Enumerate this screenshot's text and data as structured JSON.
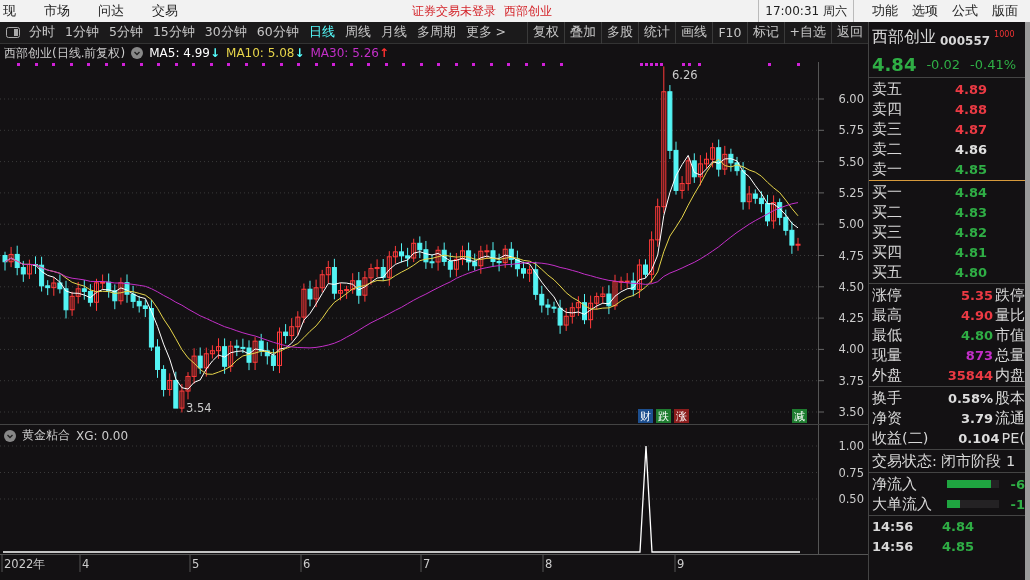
{
  "menu": [
    "现",
    "市场",
    "问达",
    "交易"
  ],
  "login_status": "证券交易未登录",
  "stock_title": "西部创业",
  "clock": "17:00:31 周六",
  "right_menu": [
    "功能",
    "选项",
    "公式",
    "版面"
  ],
  "periods": [
    {
      "label": "分时",
      "selected": false
    },
    {
      "label": "1分钟",
      "selected": false
    },
    {
      "label": "5分钟",
      "selected": false
    },
    {
      "label": "15分钟",
      "selected": false
    },
    {
      "label": "30分钟",
      "selected": false
    },
    {
      "label": "60分钟",
      "selected": false
    },
    {
      "label": "日线",
      "selected": true
    },
    {
      "label": "周线",
      "selected": false
    },
    {
      "label": "月线",
      "selected": false
    },
    {
      "label": "多周期",
      "selected": false
    }
  ],
  "more": "更多 >",
  "tools": [
    "复权",
    "叠加",
    "多股",
    "统计",
    "画线",
    "F10",
    "标记",
    "+自选",
    "返回"
  ],
  "chart": {
    "title": "西部创业(日线.前复权)",
    "ma": [
      {
        "label": "MA5: 4.99",
        "arrow": {
          "label": "↓",
          "color": "#55ffff"
        },
        "color": "#ffffff"
      },
      {
        "label": "MA10: 5.08",
        "arrow": {
          "label": "↓",
          "color": "#55ffff"
        },
        "color": "#e6d44a"
      },
      {
        "label": "MA30: 5.26",
        "arrow": {
          "label": "↑",
          "color": "#ff3030"
        },
        "color": "#c32fc8"
      }
    ],
    "y_ticks": [
      "6.00",
      "5.75",
      "5.50",
      "5.25",
      "5.00",
      "4.75",
      "4.50",
      "4.25",
      "4.00",
      "3.75",
      "3.50"
    ],
    "high_label": "6.26",
    "low_label": "3.54",
    "events": [
      {
        "label": "财",
        "color": "#1d4f8f"
      },
      {
        "label": "跌",
        "color": "#1f7d30"
      },
      {
        "label": "涨",
        "color": "#8c1d1d"
      },
      {
        "label": "减",
        "color": "#1f7d30"
      }
    ]
  },
  "indicator": {
    "title": "黄金粘合",
    "reading": "XG: 0.00",
    "y_ticks": [
      "1.00",
      "0.75",
      "0.50"
    ]
  },
  "date_axis": [
    "2022年",
    "4",
    "5",
    "6",
    "7",
    "8",
    "9"
  ],
  "quote": {
    "name": "西部创业",
    "code": "000557",
    "tag": "1000",
    "price": "4.84",
    "change": "-0.02",
    "percent": "-0.41%"
  },
  "order_book": [
    {
      "label": "卖五",
      "price": "4.89",
      "color": "#ec3a44"
    },
    {
      "label": "卖四",
      "price": "4.88",
      "color": "#ec3a44"
    },
    {
      "label": "卖三",
      "price": "4.87",
      "color": "#ec3a44"
    },
    {
      "label": "卖二",
      "price": "4.86",
      "color": "#e0e0e0"
    },
    {
      "label": "卖一",
      "price": "4.85",
      "color": "#2fae45"
    },
    {
      "label": "买一",
      "price": "4.84",
      "color": "#2fae45"
    },
    {
      "label": "买二",
      "price": "4.83",
      "color": "#2fae45"
    },
    {
      "label": "买三",
      "price": "4.82",
      "color": "#2fae45"
    },
    {
      "label": "买四",
      "price": "4.81",
      "color": "#2fae45"
    },
    {
      "label": "买五",
      "price": "4.80",
      "color": "#2fae45"
    }
  ],
  "stats": [
    {
      "label": "涨停",
      "value": "5.35",
      "color": "#ec3a44",
      "label_2": "跌停"
    },
    {
      "label": "最高",
      "value": "4.90",
      "color": "#ec3a44",
      "label_2": "量比"
    },
    {
      "label": "最低",
      "value": "4.80",
      "color": "#2fae45",
      "label_2": "市值"
    },
    {
      "label": "现量",
      "value": "873",
      "color": "#c32fc8",
      "label_2": "总量"
    },
    {
      "label": "外盘",
      "value": "35844",
      "color": "#ec3a44",
      "label_2": "内盘"
    }
  ],
  "fundamentals": [
    {
      "label": "换手",
      "value": "0.58%",
      "label_2": "股本"
    },
    {
      "label": "净资",
      "value": "3.79",
      "label_2": "流通"
    },
    {
      "label": "收益(二)",
      "value": "0.104",
      "label_2": "PE("
    }
  ],
  "trade_state": "交易状态: 闭市阶段 1",
  "flows": [
    {
      "label": "净流入",
      "level": 0.85,
      "value": "-6"
    },
    {
      "label": "大单流入",
      "level": 0.25,
      "value": "-1"
    }
  ],
  "ticks": [
    {
      "time": "14:56",
      "price": "4.84"
    },
    {
      "time": "14:56",
      "price": "4.85"
    }
  ]
}
